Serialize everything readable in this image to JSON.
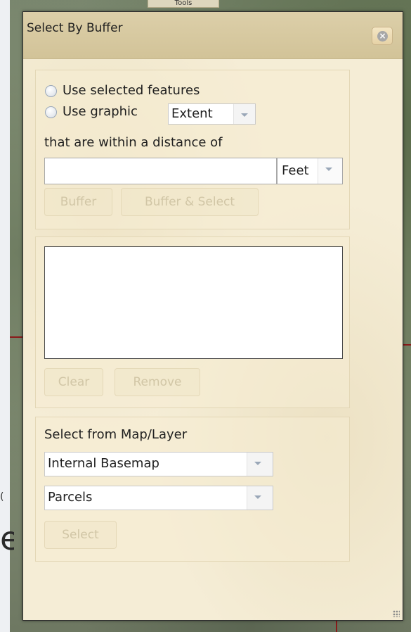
{
  "slide": {
    "edge_text": "e",
    "edge_small": "("
  },
  "tools_tab": "Tools",
  "dialog": {
    "title": "Select By Buffer",
    "buffer_panel": {
      "option_selected": "Use selected features",
      "option_graphic": "Use graphic",
      "graphic_select_value": "Extent",
      "distance_label": "that are within a distance of",
      "distance_value": "",
      "unit_select_value": "Feet",
      "buffer_button": "Buffer",
      "buffer_select_button": "Buffer & Select"
    },
    "results_panel": {
      "clear_button": "Clear",
      "remove_button": "Remove"
    },
    "layer_panel": {
      "heading": "Select from Map/Layer",
      "map_select_value": "Internal Basemap",
      "layer_select_value": "Parcels",
      "select_button": "Select"
    }
  },
  "colors": {
    "titlebar": "#d2c398",
    "dialog_bg": "#f5edd6",
    "disabled_text": "#d1c6a6"
  }
}
